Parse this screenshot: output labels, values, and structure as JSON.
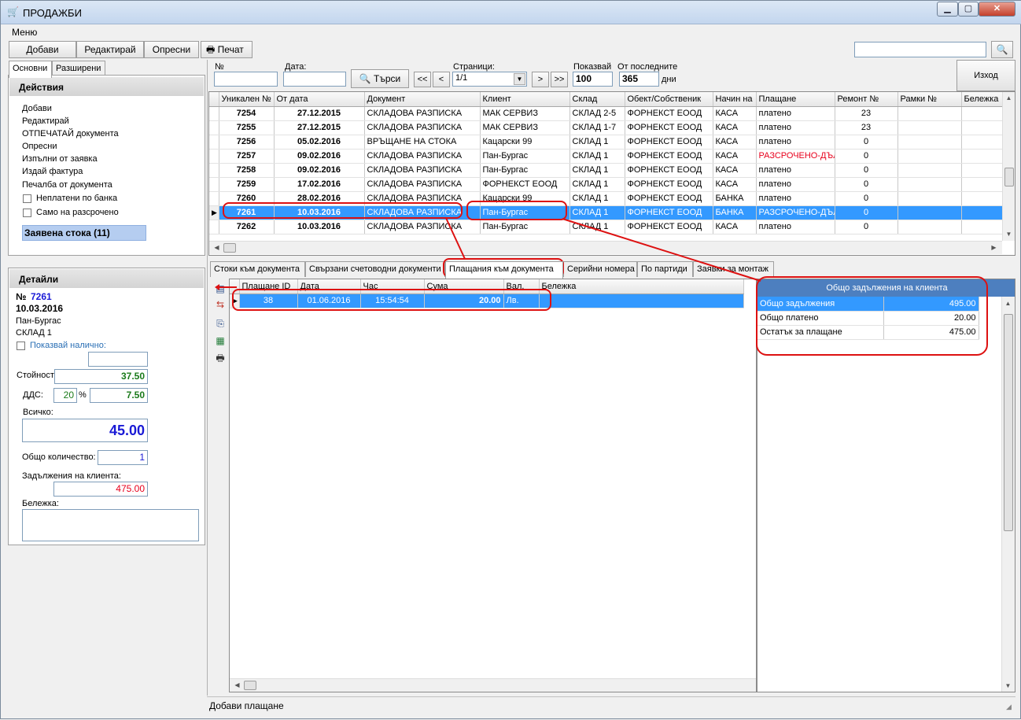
{
  "window": {
    "title": "ПРОДАЖБИ",
    "minimize": "▁",
    "maximize": "▢",
    "close": "✕"
  },
  "menu": {
    "label": "Меню"
  },
  "toolbar": {
    "add": "Добави",
    "edit": "Редактирай",
    "refresh": "Опресни",
    "print": "Печат",
    "search_icon": "magnifier-icon"
  },
  "sidebar_tabs": [
    "Основни",
    "Разширени"
  ],
  "actions": {
    "title": "Действия",
    "items": [
      "Добави",
      "Редактирай",
      "ОТПЕЧАТАЙ документа",
      "Опресни",
      "Изпълни от заявка",
      "Издай фактура",
      "Печалба от документа"
    ],
    "unpaid_bank": "Неплатени по банка",
    "installments_only": "Само на разсрочено",
    "ordered_goods": "Заявена стока (11)"
  },
  "details": {
    "title": "Детайли",
    "number_prefix": "№",
    "number": "7261",
    "date": "10.03.2016",
    "client": "Пан-Бургас",
    "warehouse": "СКЛАД 1",
    "show_available": "Показвай налично:",
    "value_label": "Стойност:",
    "value": "37.50",
    "vat_label": "ДДС:",
    "vat_percent": "20",
    "percent_sign": "%",
    "vat_value": "7.50",
    "total_label": "Всичко:",
    "total": "45.00",
    "qty_label": "Общо количество:",
    "qty": "1",
    "debts_label": "Задължения на клиента:",
    "debts": "475.00",
    "note_label": "Бележка:"
  },
  "filter": {
    "number_label": "№",
    "date_label": "Дата:",
    "search_button": "Търси",
    "pages_label": "Страници:",
    "page_value": "1/1",
    "show_label": "Показвай",
    "show_value": "100",
    "last_label": "От последните",
    "last_value": "365",
    "days_label": "дни",
    "exit": "Изход",
    "nav_first": "<<",
    "nav_prev": "<",
    "nav_next": ">",
    "nav_last": ">>"
  },
  "main_table": {
    "columns": [
      "Уникален №",
      "От дата",
      "Документ",
      "Клиент",
      "Склад",
      "Обект/Собственик",
      "Начин на",
      "Плащане",
      "Ремонт №",
      "Рамки №",
      "Бележка"
    ],
    "rows": [
      [
        "7254",
        "27.12.2015",
        "СКЛАДОВА РАЗПИСКА",
        "МАК СЕРВИЗ",
        "СКЛАД 2-5",
        "ФОРНЕКСТ ЕООД",
        "КАСА",
        "платено",
        "23",
        "",
        ""
      ],
      [
        "7255",
        "27.12.2015",
        "СКЛАДОВА РАЗПИСКА",
        "МАК СЕРВИЗ",
        "СКЛАД 1-7",
        "ФОРНЕКСТ ЕООД",
        "КАСА",
        "платено",
        "23",
        "",
        ""
      ],
      [
        "7256",
        "05.02.2016",
        "ВРЪЩАНЕ НА СТОКА",
        "Кацарски 99",
        "СКЛАД 1",
        "ФОРНЕКСТ ЕООД",
        "КАСА",
        "платено",
        "0",
        "",
        ""
      ],
      [
        "7257",
        "09.02.2016",
        "СКЛАДОВА РАЗПИСКА",
        "Пан-Бургас",
        "СКЛАД 1",
        "ФОРНЕКСТ ЕООД",
        "КАСА",
        "РАЗСРОЧЕНО-ДЪЛ",
        "0",
        "",
        ""
      ],
      [
        "7258",
        "09.02.2016",
        "СКЛАДОВА РАЗПИСКА",
        "Пан-Бургас",
        "СКЛАД 1",
        "ФОРНЕКСТ ЕООД",
        "КАСА",
        "платено",
        "0",
        "",
        ""
      ],
      [
        "7259",
        "17.02.2016",
        "СКЛАДОВА РАЗПИСКА",
        "ФОРНЕКСТ ЕООД",
        "СКЛАД 1",
        "ФОРНЕКСТ ЕООД",
        "КАСА",
        "платено",
        "0",
        "",
        ""
      ],
      [
        "7260",
        "28.02.2016",
        "СКЛАДОВА РАЗПИСКА",
        "Кацарски 99",
        "СКЛАД 1",
        "ФОРНЕКСТ ЕООД",
        "БАНКА",
        "платено",
        "0",
        "",
        ""
      ],
      [
        "7261",
        "10.03.2016",
        "СКЛАДОВА РАЗПИСКА",
        "Пан-Бургас",
        "СКЛАД 1",
        "ФОРНЕКСТ ЕООД",
        "БАНКА",
        "РАЗСРОЧЕНО-ДЪЛ",
        "0",
        "",
        ""
      ],
      [
        "7262",
        "10.03.2016",
        "СКЛАДОВА РАЗПИСКА",
        "Пан-Бургас",
        "СКЛАД 1",
        "ФОРНЕКСТ ЕООД",
        "КАСА",
        "платено",
        "0",
        "",
        ""
      ]
    ],
    "selected_index": 7
  },
  "bottom_tabs": [
    "Стоки към документа",
    "Свързани счетоводни документи",
    "Плащания към документа",
    "Серийни номера",
    "По партиди",
    "Заявки за монтаж"
  ],
  "active_bottom_tab": 2,
  "payments": {
    "columns": [
      "Плащане ID",
      "Дата",
      "Час",
      "Сума",
      "Вал.",
      "Бележка"
    ],
    "rows": [
      [
        "38",
        "01.06.2016",
        "15:54:54",
        "20.00",
        "Лв.",
        ""
      ]
    ]
  },
  "client_debts": {
    "title": "Общо задължения на клиента",
    "rows": [
      [
        "Общо задължения",
        "495.00"
      ],
      [
        "Общо платено",
        "20.00"
      ],
      [
        "Остатък за плащане",
        "475.00"
      ]
    ]
  },
  "status": {
    "text": "Добави плащане"
  },
  "colors": {
    "selection": "#3399ff",
    "annotation": "#d11111",
    "accent_blue": "#1a1ad6",
    "green": "#1a7a1a",
    "red": "#e8001c"
  }
}
